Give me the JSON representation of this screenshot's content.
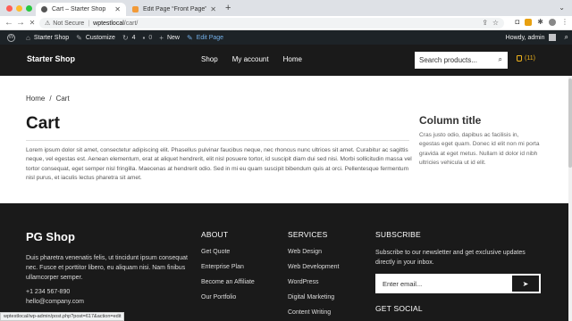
{
  "browser": {
    "tabs": [
      {
        "label": "Cart – Starter Shop",
        "active": true
      },
      {
        "label": "Edit Page “Front Page” ‹ Starter",
        "active": false
      }
    ],
    "new_tab": "+",
    "tab_search": "⌄",
    "back": "←",
    "forward": "→",
    "reload": "✕",
    "security_label": "Not Secure",
    "url_host": "wptestlocal",
    "url_path": "/cart/"
  },
  "adminbar": {
    "wp_logo": "W",
    "site_name": "Starter Shop",
    "customize": "Customize",
    "updates_count": "4",
    "comments_count": "0",
    "new_label": "New",
    "edit_page": "Edit Page",
    "howdy": "Howdy, admin"
  },
  "header": {
    "brand": "Starter Shop",
    "nav": [
      "Shop",
      "My account",
      "Home"
    ],
    "search_placeholder": "Search products...",
    "cart_count": "(11)"
  },
  "main": {
    "breadcrumb": [
      "Home",
      "Cart"
    ],
    "breadcrumb_sep": "/",
    "title": "Cart",
    "body": "Lorem ipsum dolor sit amet, consectetur adipiscing elit. Phasellus pulvinar faucibus neque, nec rhoncus nunc ultrices sit amet. Curabitur ac sagittis neque, vel egestas est. Aenean elementum, erat at aliquet hendrerit, elit nisl posuere tortor, id suscipit diam dui sed nisi. Morbi sollicitudin massa vel tortor consequat, eget semper nisl fringilla. Maecenas at hendrerit odio. Sed in mi eu quam suscipit bibendum quis at orci. Pellentesque fermentum nisl purus, et iaculis lectus pharetra sit amet."
  },
  "sidebar": {
    "title": "Column title",
    "body": "Cras justo odio, dapibus ac facilisis in, egestas eget quam. Donec id elit non mi porta gravida at eget metus. Nullam id dolor id nibh ultricies vehicula ut id elit."
  },
  "footer": {
    "title": "PG Shop",
    "desc": "Duis pharetra venenatis felis, ut tincidunt ipsum consequat nec. Fusce et porttitor libero, eu aliquam nisi. Nam finibus ullamcorper semper.",
    "phone": "+1 234 567-890",
    "email": "hello@company.com",
    "about": {
      "title": "ABOUT",
      "items": [
        "Get Quote",
        "Enterprise Plan",
        "Become an Affiliate",
        "Our Portfolio"
      ]
    },
    "services": {
      "title": "SERVICES",
      "items": [
        "Web Design",
        "Web Development",
        "WordPress",
        "Digital Marketing",
        "Content Writing"
      ]
    },
    "subscribe": {
      "title": "SUBSCRIBE",
      "desc": "Subscribe to our newsletter and get exclusive updates directly in your inbox.",
      "placeholder": "Enter email..."
    },
    "social_title": "GET SOCIAL"
  },
  "status_url": "wptestlocal/wp-admin/post.php?post=617&action=edit"
}
